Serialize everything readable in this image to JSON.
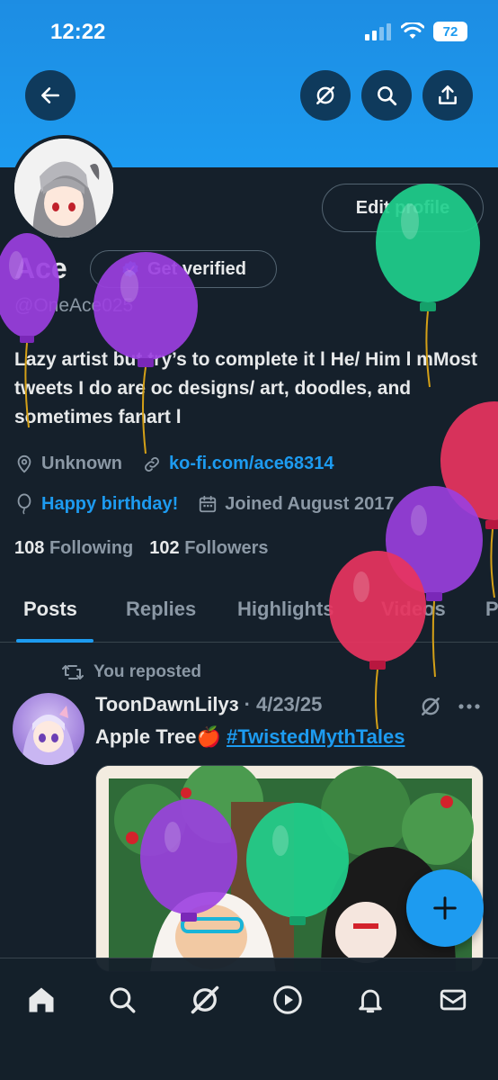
{
  "status_bar": {
    "time": "12:22",
    "battery": "72"
  },
  "profile": {
    "display_name": "Ace",
    "handle": "@OneAce025",
    "get_verified_label": "Get verified",
    "edit_profile_label": "Edit profile",
    "bio": "Lazy artist but try’s to complete it l He/ Him l mMost tweets I do are oc designs/ art, doodles, and sometimes fanart l",
    "location": "Unknown",
    "website": "ko-fi.com/ace68314",
    "birthday": "Happy birthday!",
    "joined": "Joined August 2017",
    "following_count": "108",
    "following_label": "Following",
    "followers_count": "102",
    "followers_label": "Followers"
  },
  "tabs": [
    {
      "label": "Posts",
      "active": true
    },
    {
      "label": "Replies"
    },
    {
      "label": "Highlights"
    },
    {
      "label": "Videos"
    },
    {
      "label": "P"
    }
  ],
  "post": {
    "repost_text": "You reposted",
    "author": "ToonDawnLilyз",
    "separator": "·",
    "date": "4/23/25",
    "text": "Apple Tree🍎",
    "hashtag": "#TwistedMythTales"
  },
  "colors": {
    "accent": "#1d9bf0",
    "background": "#15202b",
    "muted": "#8b98a5",
    "balloon_purple": "#9b3fe0",
    "balloon_green": "#1fcf8c",
    "balloon_red": "#e8345f"
  },
  "icons": {
    "back": "arrow-left-icon",
    "grok": "grok-icon",
    "search": "search-icon",
    "share": "share-icon",
    "location": "location-pin-icon",
    "link": "link-icon",
    "birthday": "balloon-icon",
    "calendar": "calendar-icon",
    "repost": "repost-icon",
    "more": "more-icon",
    "compose": "plus-icon",
    "nav": [
      "home-icon",
      "search-icon",
      "grok-icon",
      "video-icon",
      "bell-icon",
      "mail-icon"
    ]
  }
}
